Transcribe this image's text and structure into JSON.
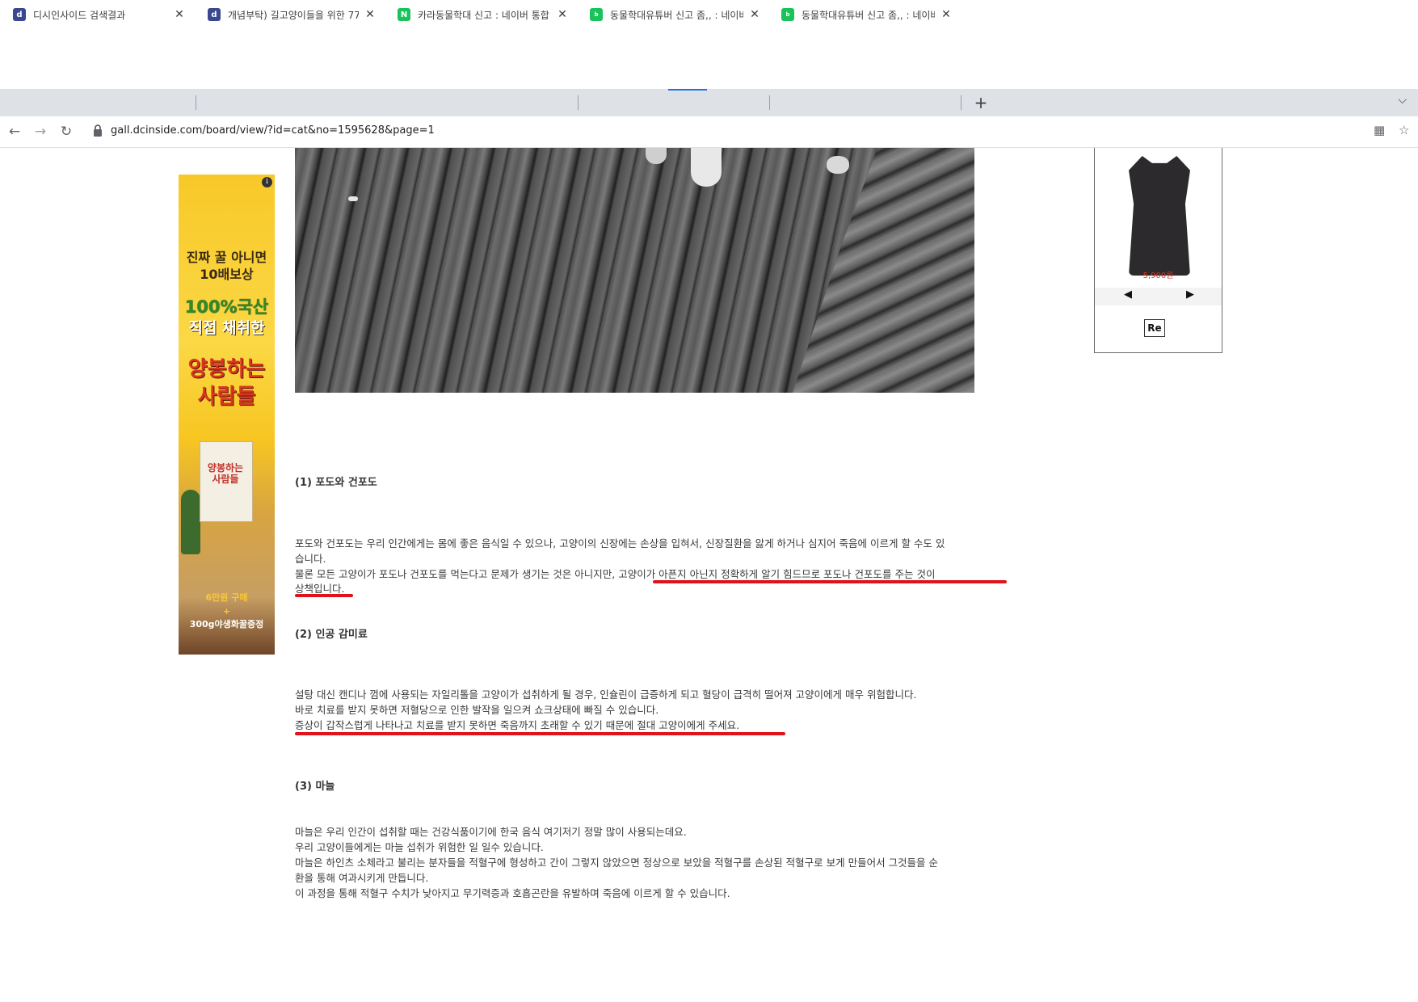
{
  "browser": {
    "tabs": [
      {
        "title": "디시인사이드 검색결과",
        "favicon": "dcinside-icon",
        "active": false
      },
      {
        "title": "개념부탁) 길고양이들을 위한 77",
        "favicon": "dcinside-icon",
        "active": true
      },
      {
        "title": "카라동물학대 신고 : 네이버 통합",
        "favicon": "naver-icon",
        "active": false
      },
      {
        "title": "동물학대유튜버 신고 좀,, : 네이버",
        "favicon": "naver-blog-icon",
        "active": false
      },
      {
        "title": "동물학대유튜버 신고 좀,, : 네이버",
        "favicon": "naver-blog-icon",
        "active": false
      }
    ],
    "url": "gall.dcinside.com/board/view/?id=cat&no=1595628&page=1"
  },
  "ad_left": {
    "line1": "진짜 꿀 아니면",
    "line2": "10배보상",
    "line3": "100%국산",
    "line4": "직접 채취한",
    "line5": "양봉하는",
    "line6": "사람들",
    "bag_text": "양봉하는 사람들",
    "line7": "6만원 구매",
    "line8": "+",
    "line9": "300g야생화꿀증정"
  },
  "side_product": {
    "price": "5,900원",
    "re_label": "Re"
  },
  "article": {
    "sec1_heading": "(1) 포도와 건포도",
    "sec1_l1": "포도와 건포도는 우리 인간에게는 몸에 좋은 음식일 수 있으나, 고양이의 신장에는 손상을 입혀서, 신장질환을 앓게 하거나 심지어 죽음에 이르게 할 수도 있",
    "sec1_l2": "습니다.",
    "sec1_l3": "물론 모든 고양이가 포도나 건포도를 먹는다고 문제가 생기는 것은 아니지만, 고양이가 아픈지 아닌지 정확하게 알기 힘드므로 포도나 건포도를 주는 것이",
    "sec1_l4": "상책입니다.",
    "sec2_heading": "(2) 인공 감미료",
    "sec2_l1": "설탕 대신 캔디나 껌에 사용되는 자일리톨을 고양이가 섭취하게 될 경우, 인슐린이 급증하게 되고 혈당이 급격히 떨어져 고양이에게 매우 위험합니다.",
    "sec2_l2": "바로 치료를 받지 못하면 저혈당으로 인한 발작을 일으켜 쇼크상태에 빠질 수 있습니다.",
    "sec2_l3": "증상이 갑작스럽게 나타나고 치료를 받지 못하면 죽음까지 초래할 수 있기 때문에 절대 고양이에게 주세요.",
    "sec3_heading": "(3) 마늘",
    "sec3_l1": "마늘은 우리 인간이 섭취할 때는 건강식품이기에 한국 음식 여기저기 정말 많이 사용되는데요.",
    "sec3_l2": "우리 고양이들에게는 마늘 섭취가 위험한 일 일수 있습니다.",
    "sec3_l3": "마늘은 하인츠 소체라고 불리는 분자들을 적혈구에 형성하고 간이 그렇지 않았으면 정상으로 보았을 적혈구를 손상된 적혈구로 보게 만들어서 그것들을 순",
    "sec3_l4": "환을 통해 여과시키게 만듭니다.",
    "sec3_l5": "이 과정을 통해 적혈구 수치가 낮아지고 무기력증과 호흡곤란을 유발하며 죽음에 이르게 할 수 있습니다."
  },
  "colors": {
    "underline": "#e0121a",
    "tabbar": "#dee1e6"
  }
}
